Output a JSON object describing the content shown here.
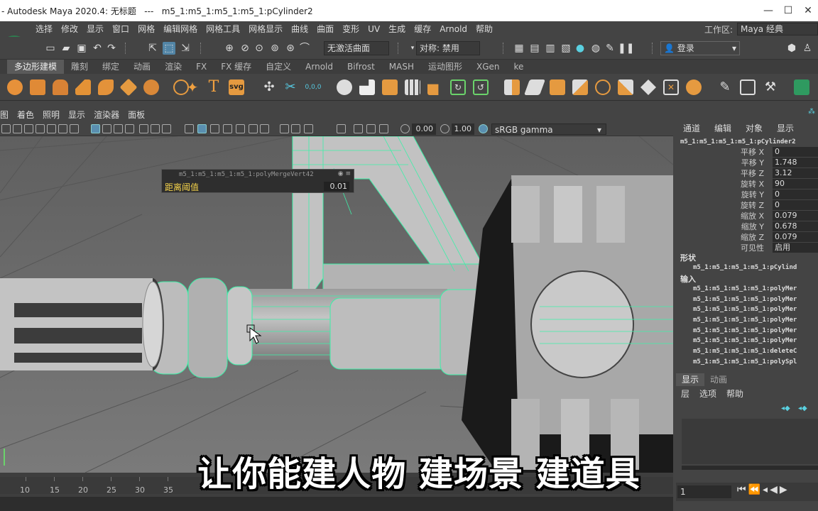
{
  "window": {
    "title": "- Autodesk Maya 2020.4: 无标题   ---   m5_1:m5_1:m5_1:m5_1:pCylinder2",
    "controls": [
      "—",
      "☐",
      "✕"
    ]
  },
  "menubar": {
    "items": [
      "选择",
      "修改",
      "显示",
      "窗口",
      "网格",
      "编辑网格",
      "网格工具",
      "网格显示",
      "曲线",
      "曲面",
      "变形",
      "UV",
      "生成",
      "缓存",
      "Arnold",
      "帮助"
    ],
    "workspace_label": "工作区:",
    "workspace_value": "Maya 经典"
  },
  "statusline": {
    "live_surface": "无激活曲面",
    "symmetry": "对称: 禁用",
    "login": "登录"
  },
  "shelf": {
    "tabs": [
      "多边形建模",
      "雕刻",
      "绑定",
      "动画",
      "渲染",
      "FX",
      "FX 缓存",
      "自定义",
      "Arnold",
      "Bifrost",
      "MASH",
      "运动图形",
      "XGen",
      "ke"
    ],
    "text_icons": {
      "type": "T",
      "svg": "svg",
      "coords": "0,0,0"
    }
  },
  "viewport": {
    "panel_menu": [
      "图",
      "着色",
      "照明",
      "显示",
      "渲染器",
      "面板"
    ],
    "exposure": "0.00",
    "gamma": "1.00",
    "color_space": "sRGB gamma",
    "inview_editor": {
      "node": "m5_1:m5_1:m5_1:m5_1:polyMergeVert42",
      "label": "距离阈值",
      "value": "0.01"
    },
    "subtitle": "让你能建人物 建场景 建道具"
  },
  "timeline": {
    "ticks": [
      "10",
      "15",
      "20",
      "25",
      "30",
      "35"
    ],
    "current_frame": "1"
  },
  "channelbox": {
    "tabs": [
      "通道",
      "编辑",
      "对象",
      "显示"
    ],
    "node": "m5_1:m5_1:m5_1:m5_1:pCylinder2",
    "attributes": [
      {
        "label": "平移 X",
        "value": "0"
      },
      {
        "label": "平移 Y",
        "value": "1.748"
      },
      {
        "label": "平移 Z",
        "value": "3.12"
      },
      {
        "label": "旋转 X",
        "value": "90"
      },
      {
        "label": "旋转 Y",
        "value": "0"
      },
      {
        "label": "旋转 Z",
        "value": "0"
      },
      {
        "label": "缩放 X",
        "value": "0.079"
      },
      {
        "label": "缩放 Y",
        "value": "0.678"
      },
      {
        "label": "缩放 Z",
        "value": "0.079"
      },
      {
        "label": "可见性",
        "value": "启用"
      }
    ],
    "shapes_label": "形状",
    "shape_node": "m5_1:m5_1:m5_1:m5_1:pCylind",
    "inputs_label": "输入",
    "inputs": [
      "m5_1:m5_1:m5_1:m5_1:polyMer",
      "m5_1:m5_1:m5_1:m5_1:polyMer",
      "m5_1:m5_1:m5_1:m5_1:polyMer",
      "m5_1:m5_1:m5_1:m5_1:polyMer",
      "m5_1:m5_1:m5_1:m5_1:polyMer",
      "m5_1:m5_1:m5_1:m5_1:polyMer",
      "m5_1:m5_1:m5_1:m5_1:deleteC",
      "m5_1:m5_1:m5_1:m5_1:polySpl"
    ]
  },
  "layereditor": {
    "tabs": [
      "显示",
      "动画"
    ],
    "menu": [
      "层",
      "选项",
      "帮助"
    ]
  }
}
